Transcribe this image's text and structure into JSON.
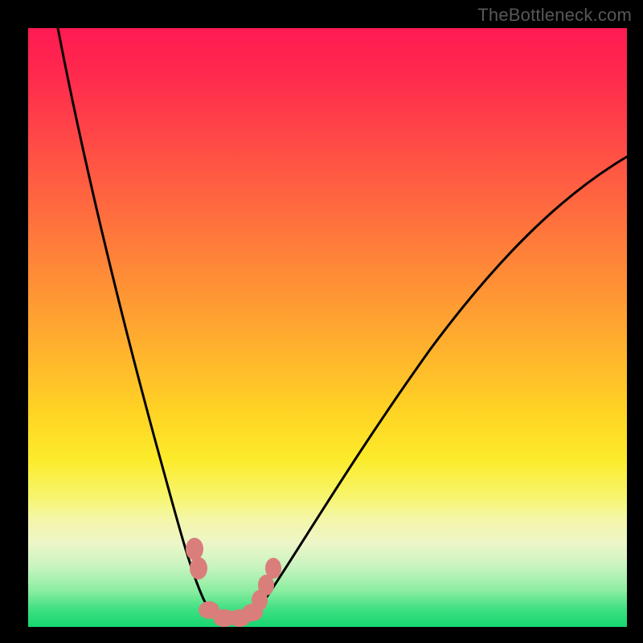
{
  "watermark": {
    "text": "TheBottleneck.com"
  },
  "colors": {
    "frame": "#000000",
    "gradient_top": "#ff1a52",
    "gradient_bottom": "#16d66f",
    "curve_stroke": "#000000",
    "marker_fill": "#d97e7b"
  },
  "chart_data": {
    "type": "line",
    "title": "",
    "xlabel": "",
    "ylabel": "",
    "xlim": [
      0,
      100
    ],
    "ylim": [
      0,
      100
    ],
    "grid": false,
    "legend": false,
    "note": "Bottleneck-style V-curve. x is component balance (left=GPU-limited, right=CPU-limited); y is bottleneck % (0 = no bottleneck). Values estimated from pixel geometry.",
    "series": [
      {
        "name": "bottleneck-curve",
        "x": [
          5,
          10,
          15,
          20,
          22,
          24,
          26,
          28,
          30,
          32,
          34,
          35,
          36,
          38,
          40,
          42,
          44,
          48,
          55,
          65,
          75,
          85,
          95,
          100
        ],
        "y": [
          100,
          82,
          63,
          44,
          36,
          27,
          18,
          10,
          4,
          1,
          0,
          0,
          0,
          1,
          3,
          6,
          10,
          17,
          28,
          42,
          54,
          63,
          71,
          75
        ]
      }
    ],
    "markers": {
      "name": "highlighted-points",
      "x": [
        27.5,
        28.2,
        30.0,
        32.5,
        35.0,
        37.0,
        38.3,
        39.3,
        40.5
      ],
      "y": [
        13.0,
        10.0,
        2.5,
        1.0,
        1.0,
        1.5,
        3.5,
        6.0,
        9.0
      ]
    }
  }
}
